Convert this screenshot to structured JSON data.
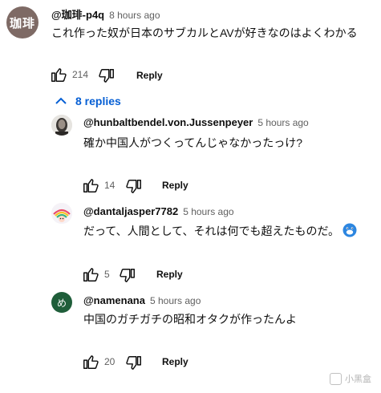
{
  "comment": {
    "avatar_text": "珈琲",
    "author": "@珈琲-p4q",
    "time": "8 hours ago",
    "text": "これ作った奴が日本のサブカルとAVが好きなのはよくわかる",
    "likes": "214",
    "reply_label": "Reply"
  },
  "replies_toggle": {
    "label": "8 replies"
  },
  "replies": [
    {
      "author": "@hunbaltbendel.von.Jussenpeyer",
      "time": "5 hours ago",
      "text": "確か中国人がつくってんじゃなかったっけ?",
      "likes": "14",
      "reply_label": "Reply"
    },
    {
      "author": "@dantaljasper7782",
      "time": "5 hours ago",
      "text": "だって、人間として、それは何でも超えたものだ。",
      "likes": "5",
      "reply_label": "Reply"
    },
    {
      "author": "@namenana",
      "avatar_text": "め",
      "time": "5 hours ago",
      "text": "中国のガチガチの昭和オタクが作ったんよ",
      "likes": "20",
      "reply_label": "Reply"
    }
  ],
  "watermark": {
    "text": "小黑盒"
  },
  "icons": {
    "like": "thumb-up-icon",
    "dislike": "thumb-down-icon",
    "collapse": "chevron-up-icon",
    "emoji": "emoji-icon"
  }
}
